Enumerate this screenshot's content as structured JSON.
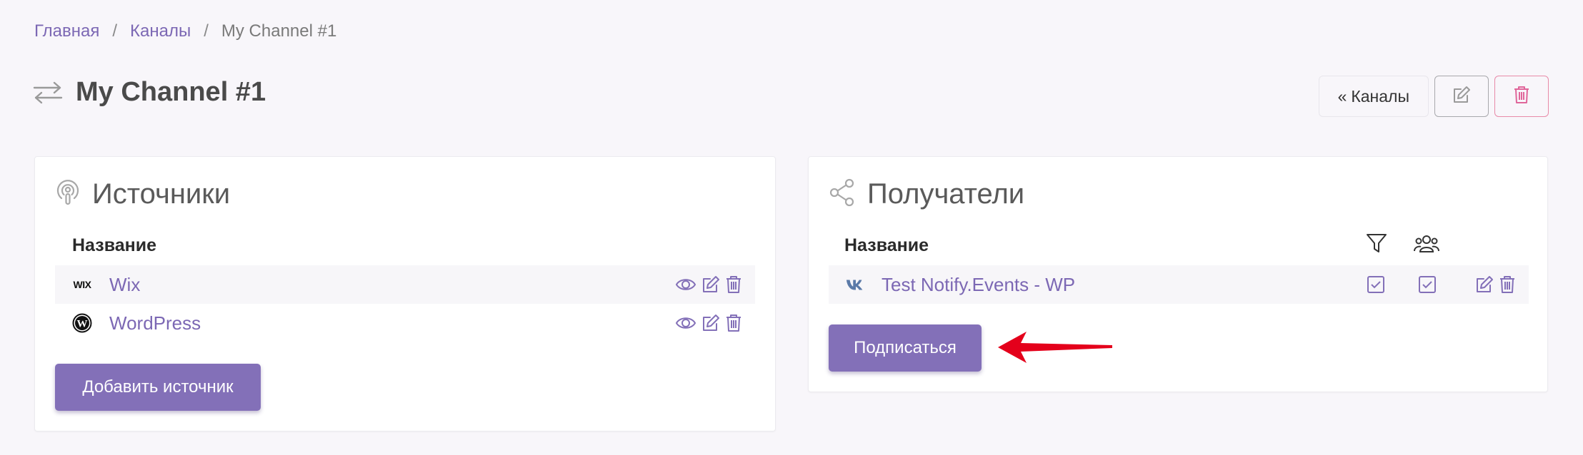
{
  "breadcrumb": {
    "home": "Главная",
    "channels": "Каналы",
    "current": "My Channel #1",
    "separator": "/"
  },
  "page": {
    "title": "My Channel #1"
  },
  "actions": {
    "back_label": "Каналы",
    "back_glyph": "«"
  },
  "sources": {
    "title": "Источники",
    "column_name": "Название",
    "items": [
      {
        "name": "Wix",
        "logo": "WIX"
      },
      {
        "name": "WordPress",
        "logo": "wordpress-logo"
      }
    ],
    "add_button": "Добавить источник"
  },
  "recipients": {
    "title": "Получатели",
    "column_name": "Название",
    "items": [
      {
        "name": "Test Notify.Events - WP",
        "logo": "vk-logo",
        "filter_checked": true,
        "group_checked": true
      }
    ],
    "subscribe_button": "Подписаться"
  },
  "colors": {
    "accent": "#8370b8",
    "link": "#7c68b4",
    "danger": "#e0669a",
    "arrow": "#e4001b"
  }
}
